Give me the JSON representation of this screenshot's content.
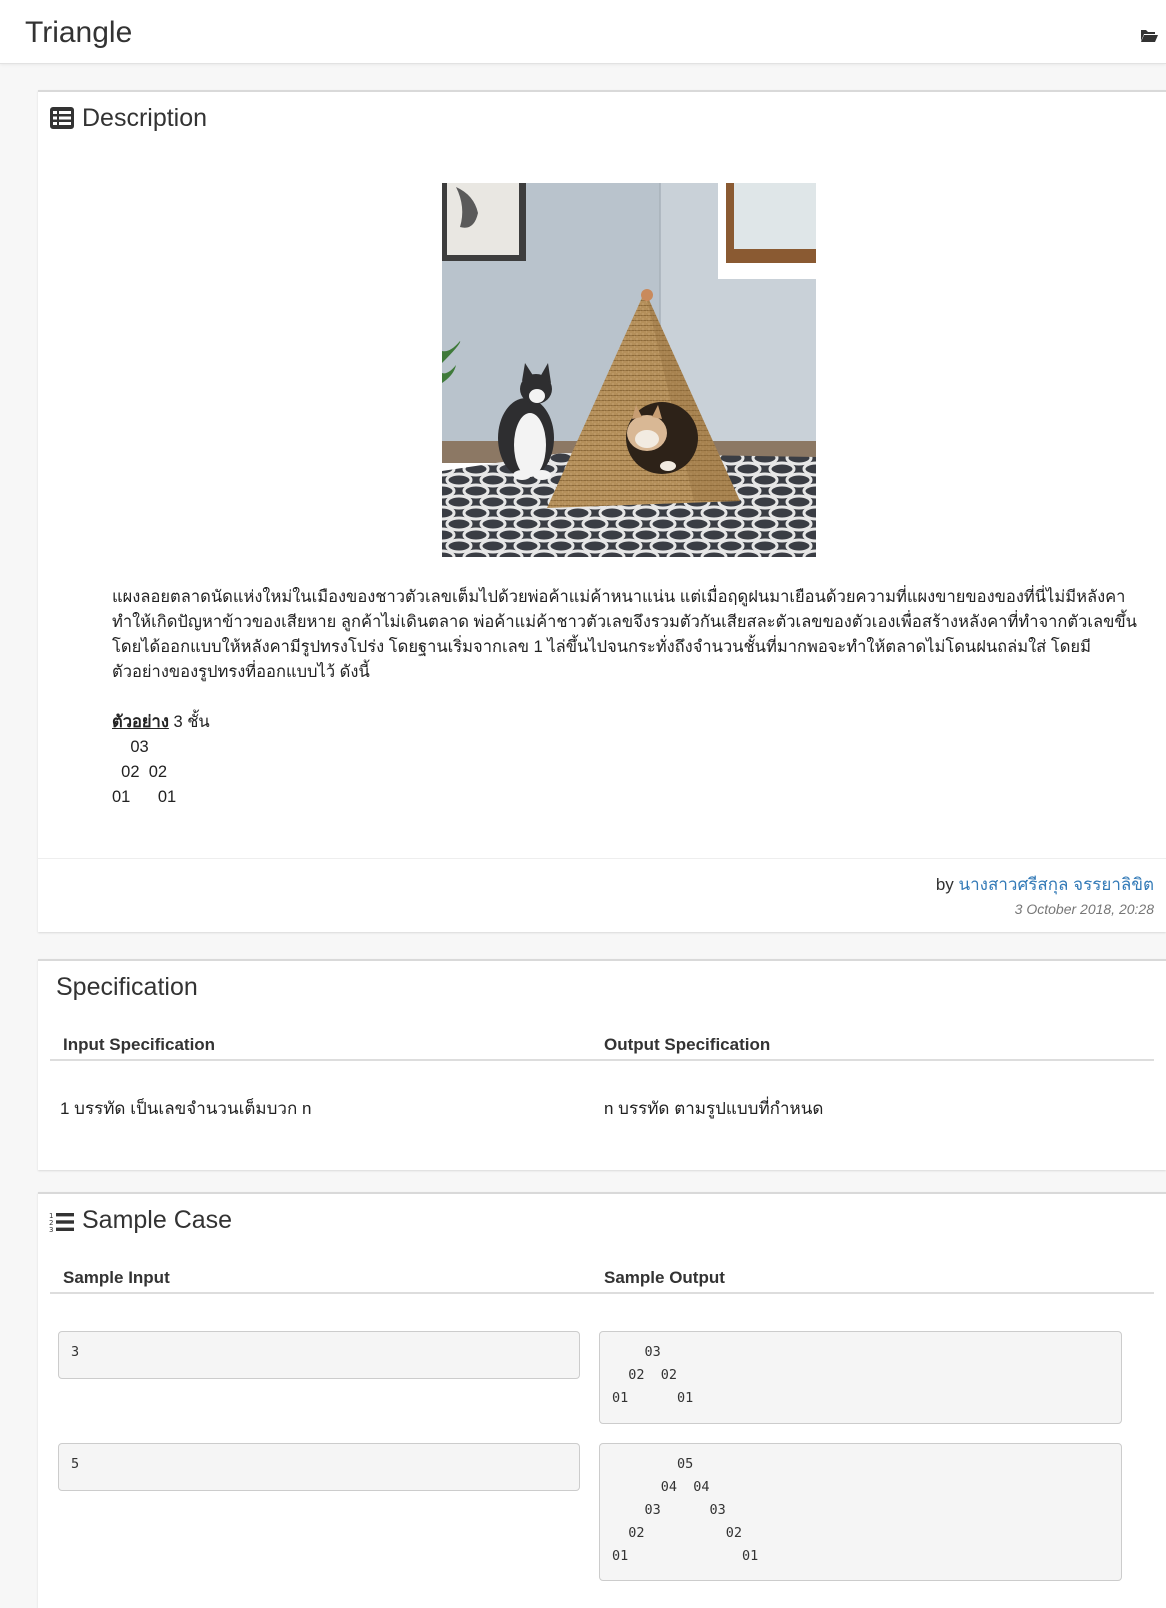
{
  "header": {
    "title": "Triangle",
    "folder_icon": "folder-open-icon"
  },
  "description": {
    "heading": "Description",
    "heading_icon": "list-alt-icon",
    "image_alt": "Two cats beside a woven pyramid cat house",
    "paragraph_lines": [
      "แผงลอยตลาดนัดแห่งใหม่ในเมืองของชาวตัวเลขเต็มไปด้วยพ่อค้าแม่ค้าหนาแน่น แต่เมื่อฤดูฝนมาเยือนด้วยความที่แผงขายของของที่นี่ไม่มีหลังคา",
      "ทำให้เกิดปัญหาข้าวของเสียหาย ลูกค้าไม่เดินตลาด พ่อค้าแม่ค้าชาวตัวเลขจึงรวมตัวกันเสียสละตัวเลขของตัวเองเพื่อสร้างหลังคาที่ทำจากตัวเลขขึ้น",
      "โดยได้ออกแบบให้หลังคามีรูปทรงโปร่ง โดยฐานเริ่มจากเลข 1 ไล่ขึ้นไปจนกระทั่งถึงจำนวนชั้นที่มากพอจะทำให้ตลาดไม่โดนฝนถล่มใส่ โดยมี",
      "ตัวอย่างของรูปทรงที่ออกแบบไว้ ดังนี้"
    ],
    "example_label": "ตัวอย่าง",
    "example_suffix": " 3 ชั้น",
    "example_pattern": "    03\n  02  02\n01      01",
    "by_label": "by ",
    "author": "นางสาวศรีสกุล จรรยาลิขิต",
    "date": "3 October 2018, 20:28"
  },
  "specification": {
    "heading": "Specification",
    "input_header": "Input Specification",
    "output_header": "Output Specification",
    "input_text": "1 บรรทัด เป็นเลขจำนวนเต็มบวก n",
    "output_text": "n บรรทัด ตามรูปแบบที่กำหนด"
  },
  "samples": {
    "heading": "Sample Case",
    "heading_icon": "list-ol-icon",
    "input_header": "Sample Input",
    "output_header": "Sample Output",
    "cases": [
      {
        "input": "3",
        "output": "    03\n  02  02\n01      01"
      },
      {
        "input": "5",
        "output": "        05\n      04  04\n    03      03\n  02          02\n01              01"
      }
    ]
  }
}
